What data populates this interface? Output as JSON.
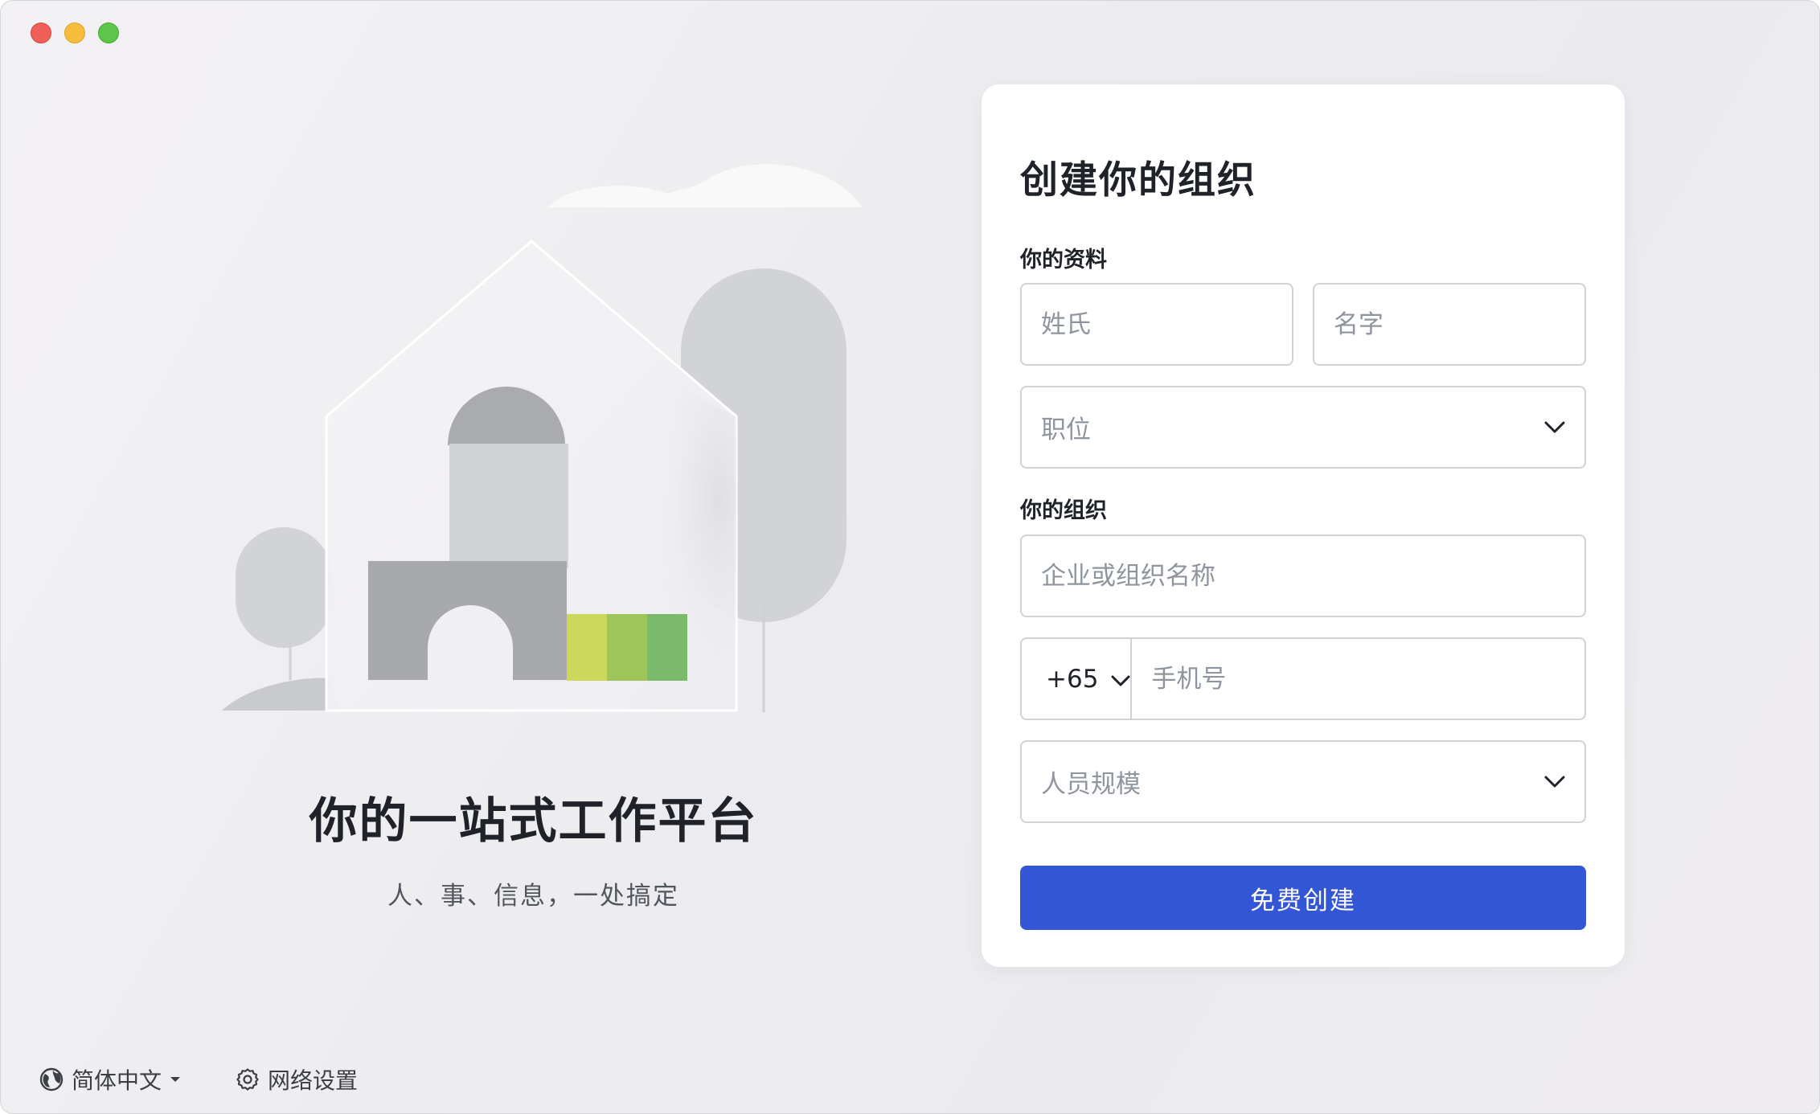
{
  "window": {
    "traffic_lights": [
      "close",
      "minimize",
      "maximize"
    ]
  },
  "hero": {
    "title": "你的一站式工作平台",
    "subtitle": "人、事、信息，一处搞定"
  },
  "bottom_bar": {
    "language_label": "简体中文",
    "language_icon": "globe-icon",
    "network_label": "网络设置",
    "network_icon": "gear-icon"
  },
  "form": {
    "title": "创建你的组织",
    "profile_section": "你的资料",
    "last_name_placeholder": "姓氏",
    "first_name_placeholder": "名字",
    "position_placeholder": "职位",
    "org_section": "你的组织",
    "org_name_placeholder": "企业或组织名称",
    "country_code": "+65",
    "phone_placeholder": "手机号",
    "team_size_placeholder": "人员规模",
    "submit_label": "免费创建"
  },
  "colors": {
    "primary": "#3256d5",
    "card_bg": "#ffffff",
    "text_primary": "#1f2329",
    "text_placeholder": "#8f959e",
    "border": "#d0d3d6",
    "illustration_green_1": "#cbd85c",
    "illustration_green_2": "#9dc55a",
    "illustration_green_3": "#7bb96b"
  }
}
